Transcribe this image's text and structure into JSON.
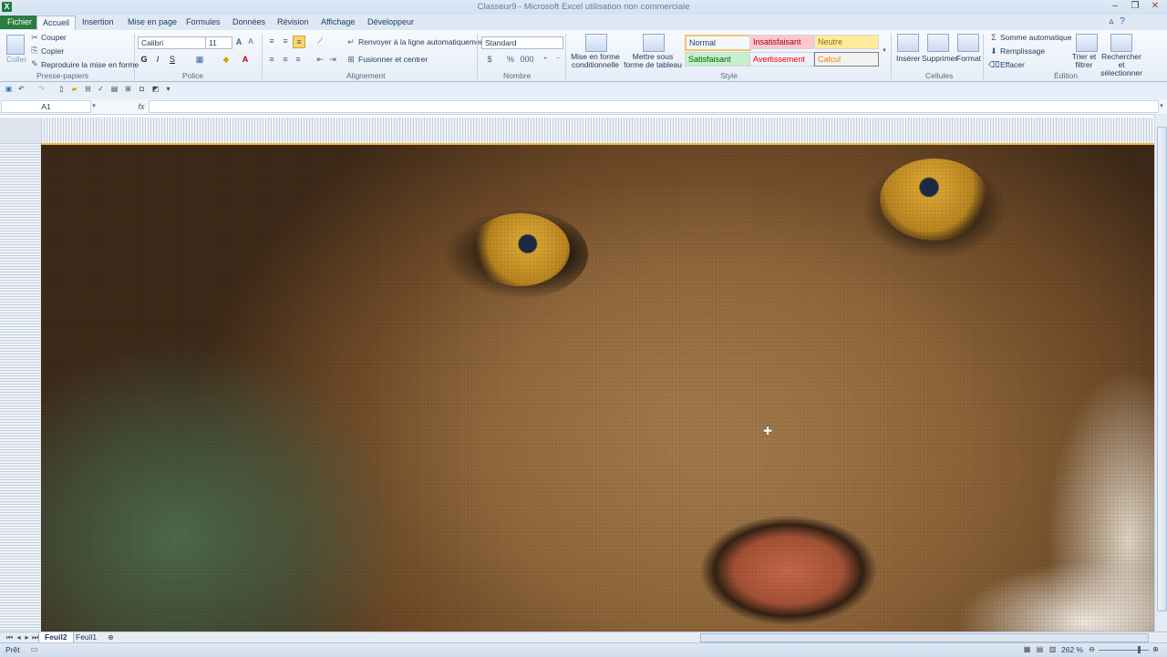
{
  "window": {
    "title": "Classeur9 - Microsoft Excel utilisation non commerciale",
    "app_icon": "excel-icon"
  },
  "tabs": [
    "Fichier",
    "Accueil",
    "Insertion",
    "Mise en page",
    "Formules",
    "Données",
    "Révision",
    "Affichage",
    "Développeur"
  ],
  "active_tab": "Accueil",
  "ribbon": {
    "clipboard": {
      "paste": "Coller",
      "cut": "Couper",
      "copy": "Copier",
      "format_painter": "Reproduire la mise en forme",
      "label": "Presse-papiers"
    },
    "font": {
      "name": "Calibri",
      "size": "11",
      "bold": "G",
      "italic": "I",
      "underline": "S",
      "label": "Police"
    },
    "alignment": {
      "wrap": "Renvoyer à la ligne automatiquement",
      "merge": "Fusionner et centrer",
      "label": "Alignement"
    },
    "number": {
      "format": "Standard",
      "label": "Nombre"
    },
    "styles": {
      "conditional": "Mise en forme conditionnelle",
      "as_table": "Mettre sous forme de tableau",
      "cells": [
        {
          "name": "Normal",
          "color": "#000000",
          "bg": "#ffffff"
        },
        {
          "name": "Insatisfaisant",
          "color": "#9c0006",
          "bg": "#ffc7ce"
        },
        {
          "name": "Neutre",
          "color": "#9c6500",
          "bg": "#ffeb9c"
        },
        {
          "name": "Satisfaisant",
          "color": "#006100",
          "bg": "#c6efce"
        },
        {
          "name": "Avertissement",
          "color": "#ff0000",
          "bg": "#ffffff"
        },
        {
          "name": "Calcul",
          "color": "#fa7d00",
          "bg": "#f2f2f2"
        }
      ],
      "label": "Style"
    },
    "cells": {
      "insert": "Insérer",
      "delete": "Supprimer",
      "format": "Format",
      "label": "Cellules"
    },
    "editing": {
      "autosum": "Somme automatique",
      "fill": "Remplissage",
      "clear": "Effacer",
      "sort_filter": "Trier et filtrer",
      "find_select": "Rechercher et sélectionner",
      "label": "Édition"
    }
  },
  "formula_bar": {
    "name_box": "A1",
    "fx": "fx",
    "content": ""
  },
  "sheets": [
    "Feuil2",
    "Feuil1"
  ],
  "active_sheet": "Feuil2",
  "status": {
    "ready": "Prêt",
    "zoom": "262 %"
  }
}
